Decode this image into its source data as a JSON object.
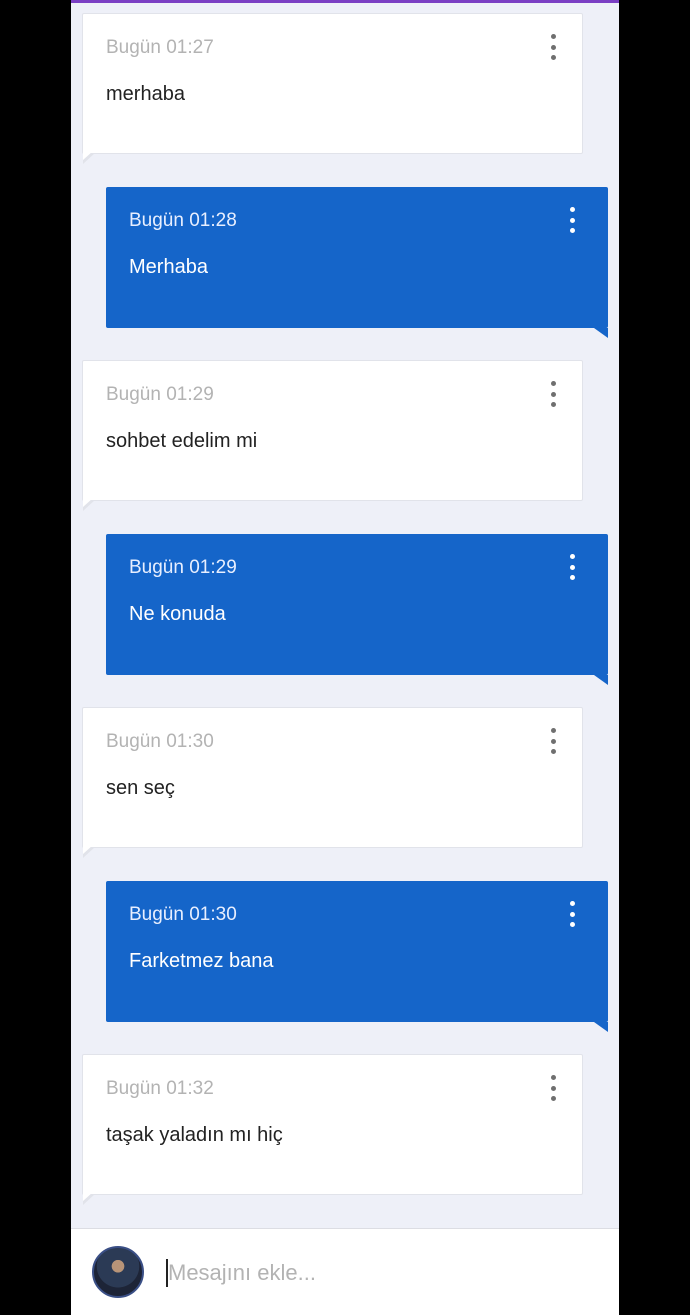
{
  "messages": [
    {
      "direction": "incoming",
      "time": "Bugün 01:27",
      "text": "merhaba"
    },
    {
      "direction": "outgoing",
      "time": "Bugün 01:28",
      "text": "Merhaba"
    },
    {
      "direction": "incoming",
      "time": "Bugün 01:29",
      "text": "sohbet edelim mi"
    },
    {
      "direction": "outgoing",
      "time": "Bugün 01:29",
      "text": "Ne konuda"
    },
    {
      "direction": "incoming",
      "time": "Bugün 01:30",
      "text": "sen seç"
    },
    {
      "direction": "outgoing",
      "time": "Bugün 01:30",
      "text": "Farketmez bana"
    },
    {
      "direction": "incoming",
      "time": "Bugün 01:32",
      "text": "taşak yaladın mı hiç"
    }
  ],
  "composer": {
    "placeholder": "Mesajını ekle...",
    "value": ""
  },
  "colors": {
    "accent": "#1565c9",
    "topbar": "#7b3fc4",
    "background": "#eef0f8"
  },
  "icons": {
    "menu": "more-vert-icon",
    "avatar": "user-avatar"
  }
}
